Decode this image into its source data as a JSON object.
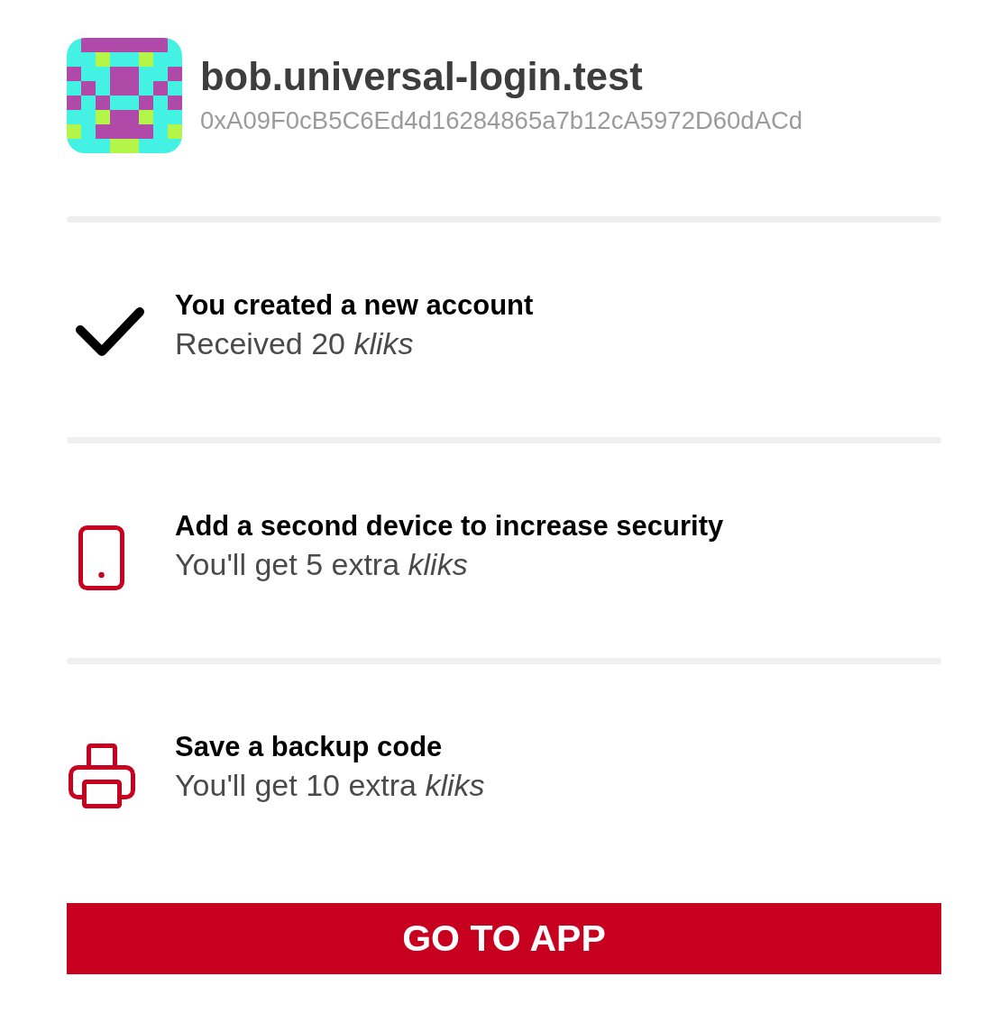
{
  "account": {
    "name": "bob.universal-login.test",
    "address": "0xA09F0cB5C6Ed4d16284865a7b12cA5972D60dACd"
  },
  "steps": [
    {
      "kind": "account",
      "done": true,
      "title": "You created a new account",
      "subtitle": "Received 20 *kliks*"
    },
    {
      "kind": "device",
      "done": false,
      "title": "Add a second device to increase security",
      "subtitle": "You'll get 5 extra *kliks*"
    },
    {
      "kind": "backup",
      "done": false,
      "title": "Save a backup code",
      "subtitle": "You'll get 10 extra *kliks*"
    }
  ],
  "button": {
    "label": "GO TO APP"
  }
}
